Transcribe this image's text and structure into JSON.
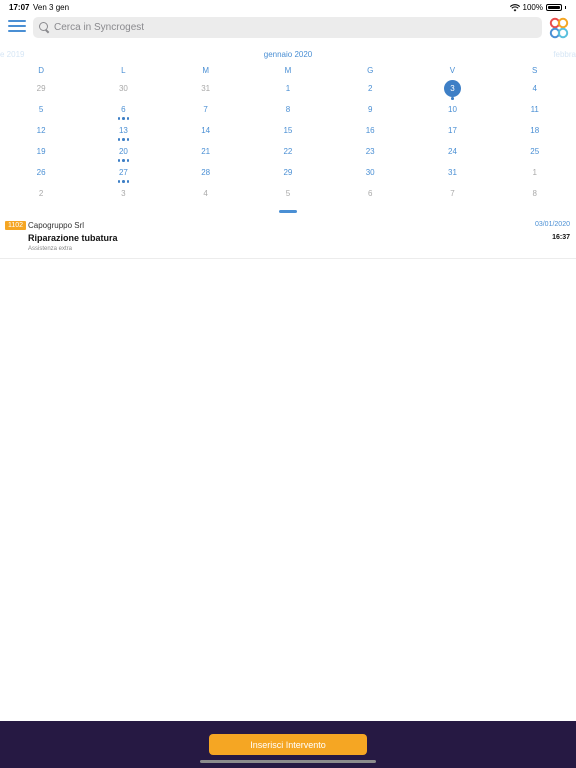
{
  "status_bar": {
    "time": "17:07",
    "date": "Ven 3 gen",
    "battery": "100%"
  },
  "search": {
    "placeholder": "Cerca in Syncrogest"
  },
  "calendar": {
    "prev_month": "e 2019",
    "current_month": "gennaio 2020",
    "next_month": "febbra",
    "weekdays": [
      "D",
      "L",
      "M",
      "M",
      "G",
      "V",
      "S"
    ],
    "weeks": [
      [
        {
          "day": "29",
          "in_month": false
        },
        {
          "day": "30",
          "in_month": false
        },
        {
          "day": "31",
          "in_month": false
        },
        {
          "day": "1",
          "in_month": true
        },
        {
          "day": "2",
          "in_month": true
        },
        {
          "day": "3",
          "in_month": true,
          "selected": true,
          "dots": 1
        },
        {
          "day": "4",
          "in_month": true
        }
      ],
      [
        {
          "day": "5",
          "in_month": true
        },
        {
          "day": "6",
          "in_month": true,
          "dots": 3
        },
        {
          "day": "7",
          "in_month": true
        },
        {
          "day": "8",
          "in_month": true
        },
        {
          "day": "9",
          "in_month": true
        },
        {
          "day": "10",
          "in_month": true
        },
        {
          "day": "11",
          "in_month": true
        }
      ],
      [
        {
          "day": "12",
          "in_month": true
        },
        {
          "day": "13",
          "in_month": true,
          "dots": 3
        },
        {
          "day": "14",
          "in_month": true
        },
        {
          "day": "15",
          "in_month": true
        },
        {
          "day": "16",
          "in_month": true
        },
        {
          "day": "17",
          "in_month": true
        },
        {
          "day": "18",
          "in_month": true
        }
      ],
      [
        {
          "day": "19",
          "in_month": true
        },
        {
          "day": "20",
          "in_month": true,
          "dots": 3
        },
        {
          "day": "21",
          "in_month": true
        },
        {
          "day": "22",
          "in_month": true
        },
        {
          "day": "23",
          "in_month": true
        },
        {
          "day": "24",
          "in_month": true
        },
        {
          "day": "25",
          "in_month": true
        }
      ],
      [
        {
          "day": "26",
          "in_month": true
        },
        {
          "day": "27",
          "in_month": true,
          "dots": 3
        },
        {
          "day": "28",
          "in_month": true
        },
        {
          "day": "29",
          "in_month": true
        },
        {
          "day": "30",
          "in_month": true
        },
        {
          "day": "31",
          "in_month": true
        },
        {
          "day": "1",
          "in_month": false
        }
      ],
      [
        {
          "day": "2",
          "in_month": false
        },
        {
          "day": "3",
          "in_month": false
        },
        {
          "day": "4",
          "in_month": false
        },
        {
          "day": "5",
          "in_month": false
        },
        {
          "day": "6",
          "in_month": false
        },
        {
          "day": "7",
          "in_month": false
        },
        {
          "day": "8",
          "in_month": false
        }
      ]
    ]
  },
  "events": [
    {
      "code": "1102",
      "client": "Capogruppo Srl",
      "date": "03/01/2020",
      "title": "Riparazione tubatura",
      "time": "16:37",
      "subtitle": "Assistenza extra"
    }
  ],
  "footer": {
    "insert_label": "Inserisci Intervento"
  },
  "colors": {
    "accent": "#4a8fd4",
    "selected": "#3e7fc6",
    "badge": "#f5a623",
    "bottom_bar": "#261943"
  }
}
